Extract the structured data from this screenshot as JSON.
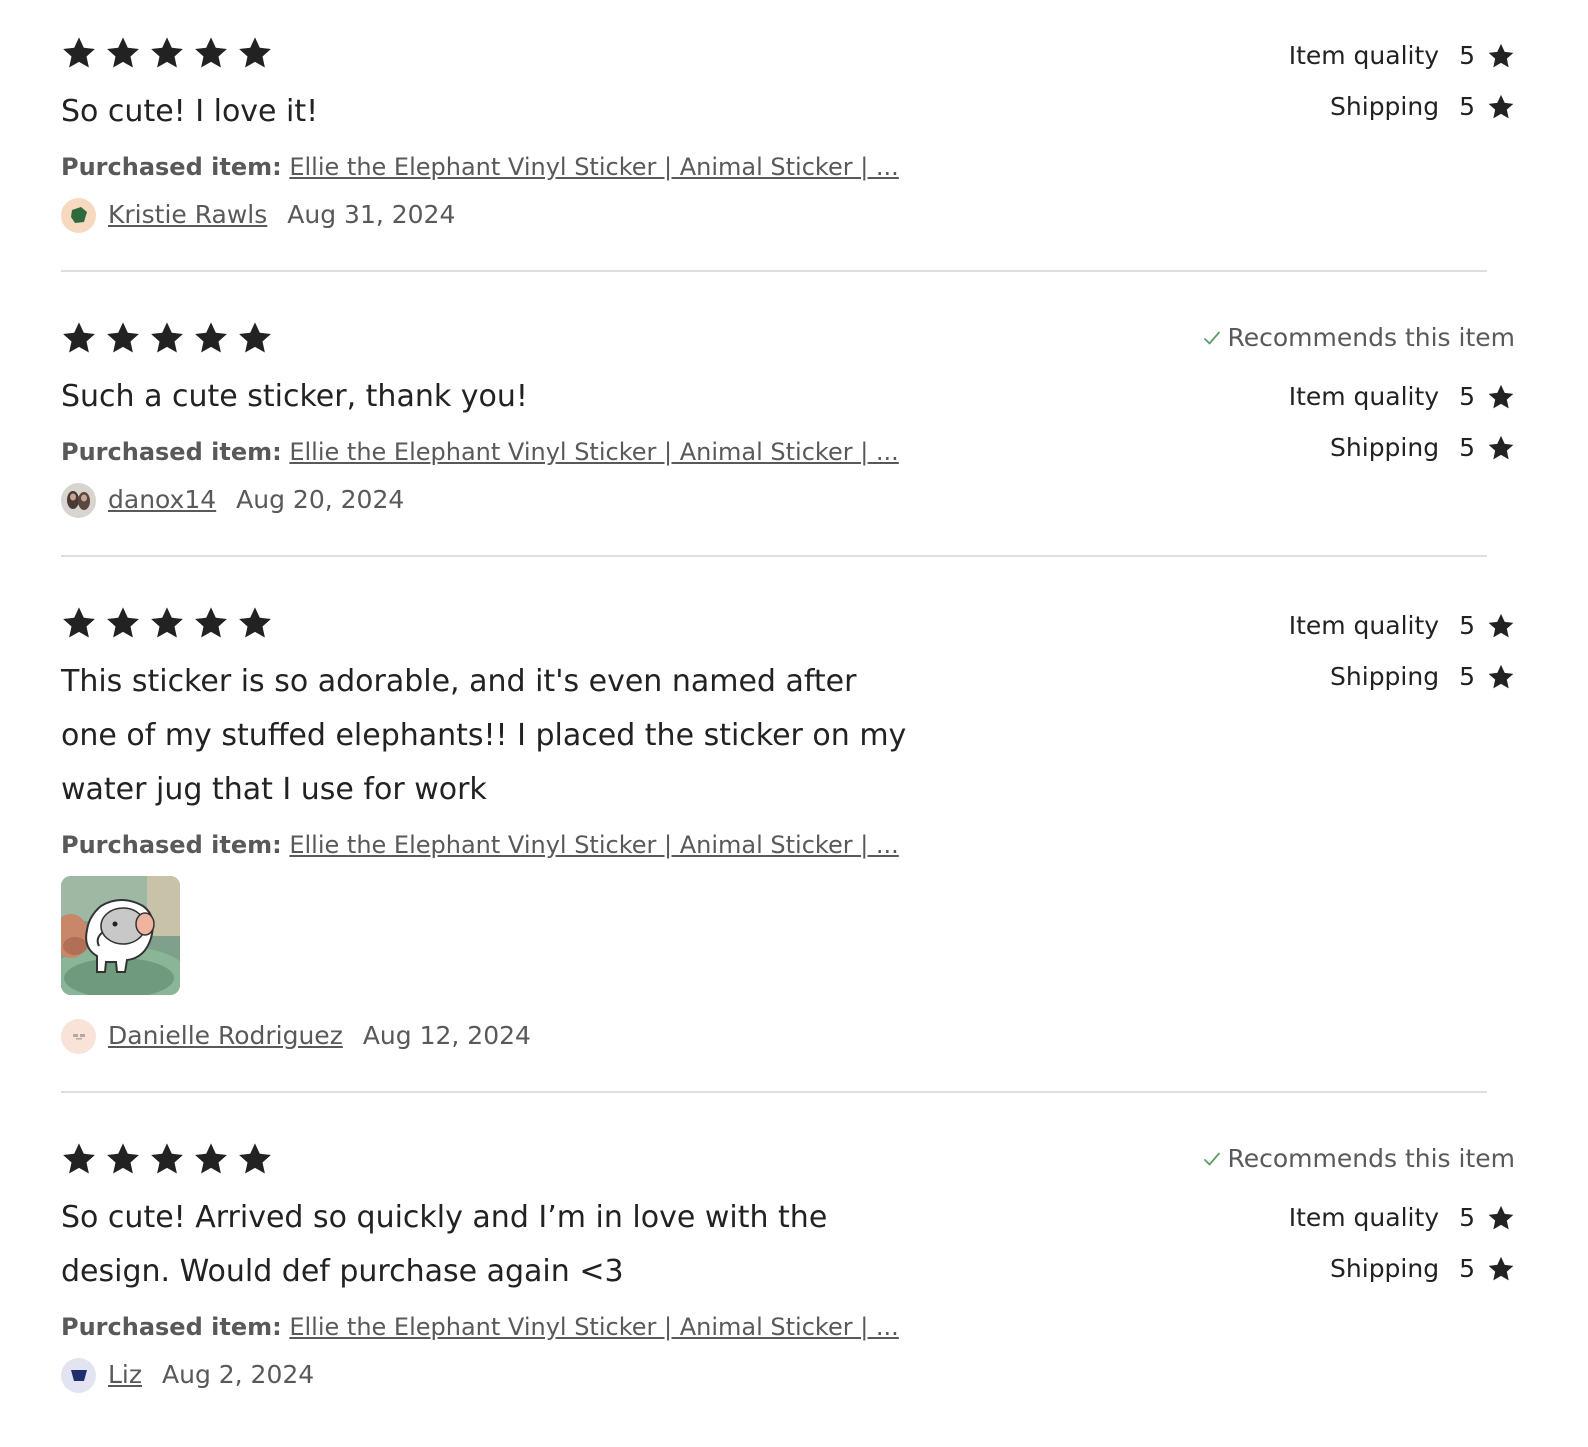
{
  "icons": {
    "star": "star-icon",
    "check": "check-icon"
  },
  "colors": {
    "star": "#222222",
    "check_mark": "#5c9e6a",
    "divider": "#dedede",
    "muted_text": "#595959"
  },
  "reviews": [
    {
      "stars": 5,
      "text": "So cute! I love it!",
      "purchased_label": "Purchased item:",
      "item_title": "Ellie the Elephant Vinyl Sticker | Animal Sticker | ...",
      "reviewer_name": "Kristie Rawls",
      "date": "Aug 31, 2024",
      "recommends": "",
      "item_quality_label": "Item quality",
      "item_quality_value": "5",
      "shipping_label": "Shipping",
      "shipping_value": "5"
    },
    {
      "stars": 5,
      "text": "Such a cute sticker, thank you!",
      "purchased_label": "Purchased item:",
      "item_title": "Ellie the Elephant Vinyl Sticker | Animal Sticker | ...",
      "reviewer_name": "danox14",
      "date": "Aug 20, 2024",
      "recommends": "Recommends this item",
      "item_quality_label": "Item quality",
      "item_quality_value": "5",
      "shipping_label": "Shipping",
      "shipping_value": "5"
    },
    {
      "stars": 5,
      "text": "This sticker is so adorable, and it's even named after one of my stuffed elephants!! I placed the sticker on my water jug that I use for work",
      "purchased_label": "Purchased item:",
      "item_title": "Ellie the Elephant Vinyl Sticker | Animal Sticker | ...",
      "reviewer_name": "Danielle Rodriguez",
      "date": "Aug 12, 2024",
      "recommends": "",
      "item_quality_label": "Item quality",
      "item_quality_value": "5",
      "shipping_label": "Shipping",
      "shipping_value": "5"
    },
    {
      "stars": 5,
      "text": "So cute! Arrived so quickly and I’m in love with the design. Would def purchase again <3",
      "purchased_label": "Purchased item:",
      "item_title": "Ellie the Elephant Vinyl Sticker | Animal Sticker | ...",
      "reviewer_name": "Liz",
      "date": "Aug 2, 2024",
      "recommends": "Recommends this item",
      "item_quality_label": "Item quality",
      "item_quality_value": "5",
      "shipping_label": "Shipping",
      "shipping_value": "5"
    }
  ]
}
